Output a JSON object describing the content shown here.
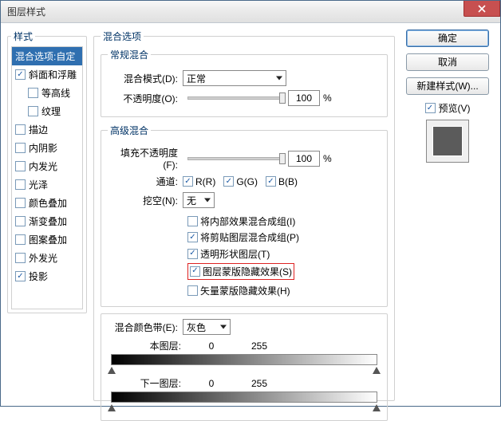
{
  "window": {
    "title": "图层样式"
  },
  "left": {
    "heading": "样式",
    "items": [
      {
        "label": "混合选项:自定",
        "checkbox": false,
        "checked": false,
        "selected": true,
        "indent": false
      },
      {
        "label": "斜面和浮雕",
        "checkbox": true,
        "checked": true,
        "selected": false,
        "indent": false
      },
      {
        "label": "等高线",
        "checkbox": true,
        "checked": false,
        "selected": false,
        "indent": true
      },
      {
        "label": "纹理",
        "checkbox": true,
        "checked": false,
        "selected": false,
        "indent": true
      },
      {
        "label": "描边",
        "checkbox": true,
        "checked": false,
        "selected": false,
        "indent": false
      },
      {
        "label": "内阴影",
        "checkbox": true,
        "checked": false,
        "selected": false,
        "indent": false
      },
      {
        "label": "内发光",
        "checkbox": true,
        "checked": false,
        "selected": false,
        "indent": false
      },
      {
        "label": "光泽",
        "checkbox": true,
        "checked": false,
        "selected": false,
        "indent": false
      },
      {
        "label": "颜色叠加",
        "checkbox": true,
        "checked": false,
        "selected": false,
        "indent": false
      },
      {
        "label": "渐变叠加",
        "checkbox": true,
        "checked": false,
        "selected": false,
        "indent": false
      },
      {
        "label": "图案叠加",
        "checkbox": true,
        "checked": false,
        "selected": false,
        "indent": false
      },
      {
        "label": "外发光",
        "checkbox": true,
        "checked": false,
        "selected": false,
        "indent": false
      },
      {
        "label": "投影",
        "checkbox": true,
        "checked": true,
        "selected": false,
        "indent": false
      }
    ]
  },
  "blending": {
    "legend_main": "混合选项",
    "legend_normal": "常规混合",
    "mode_label": "混合模式(D):",
    "mode_value": "正常",
    "opacity_label": "不透明度(O):",
    "opacity_value": "100",
    "opacity_unit": "%",
    "legend_adv": "高级混合",
    "fill_label": "填充不透明度(F):",
    "fill_value": "100",
    "fill_unit": "%",
    "channels_label": "通道:",
    "channel_r": "R(R)",
    "channel_g": "G(G)",
    "channel_b": "B(B)",
    "knockout_label": "挖空(N):",
    "knockout_value": "无",
    "adv_opts": [
      {
        "label": "将内部效果混合成组(I)",
        "checked": false,
        "highlight": false
      },
      {
        "label": "将剪贴图层混合成组(P)",
        "checked": true,
        "highlight": false
      },
      {
        "label": "透明形状图层(T)",
        "checked": true,
        "highlight": false
      },
      {
        "label": "图层蒙版隐藏效果(S)",
        "checked": true,
        "highlight": true
      },
      {
        "label": "矢量蒙版隐藏效果(H)",
        "checked": false,
        "highlight": false
      }
    ],
    "blendif_label": "混合颜色带(E):",
    "blendif_value": "灰色",
    "this_layer_label": "本图层:",
    "this_lo": "0",
    "this_hi": "255",
    "under_layer_label": "下一图层:",
    "under_lo": "0",
    "under_hi": "255"
  },
  "right": {
    "ok": "确定",
    "cancel": "取消",
    "newstyle": "新建样式(W)...",
    "preview": "预览(V)"
  }
}
